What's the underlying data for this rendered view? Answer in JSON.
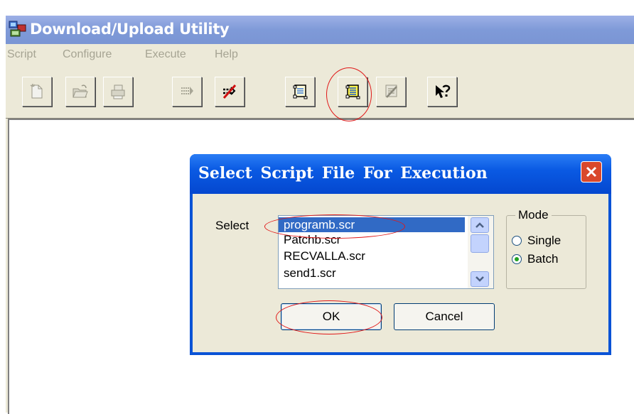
{
  "app": {
    "title": "Download/Upload Utility",
    "menu": [
      "Script",
      "Configure",
      "Execute",
      "Help"
    ],
    "toolbar_icons": [
      "new-script-icon",
      "open-folder-icon",
      "print-icon",
      "transfer-icon",
      "disconnect-icon",
      "single-script-icon",
      "batch-script-icon",
      "edit-script-icon",
      "context-help-icon"
    ]
  },
  "dialog": {
    "title": "Select  Script  File For Execution",
    "select_label": "Select",
    "files": [
      "programb.scr",
      "Patchb.scr",
      "RECVALLA.scr",
      "send1.scr"
    ],
    "selected_file": "programb.scr",
    "mode_label": "Mode",
    "mode_options": [
      "Single",
      "Batch"
    ],
    "mode_selected": "Batch",
    "ok_label": "OK",
    "cancel_label": "Cancel"
  },
  "colors": {
    "annotation": "#e01818",
    "selection": "#316ac5",
    "dialog_title": "#0a5ae3"
  }
}
